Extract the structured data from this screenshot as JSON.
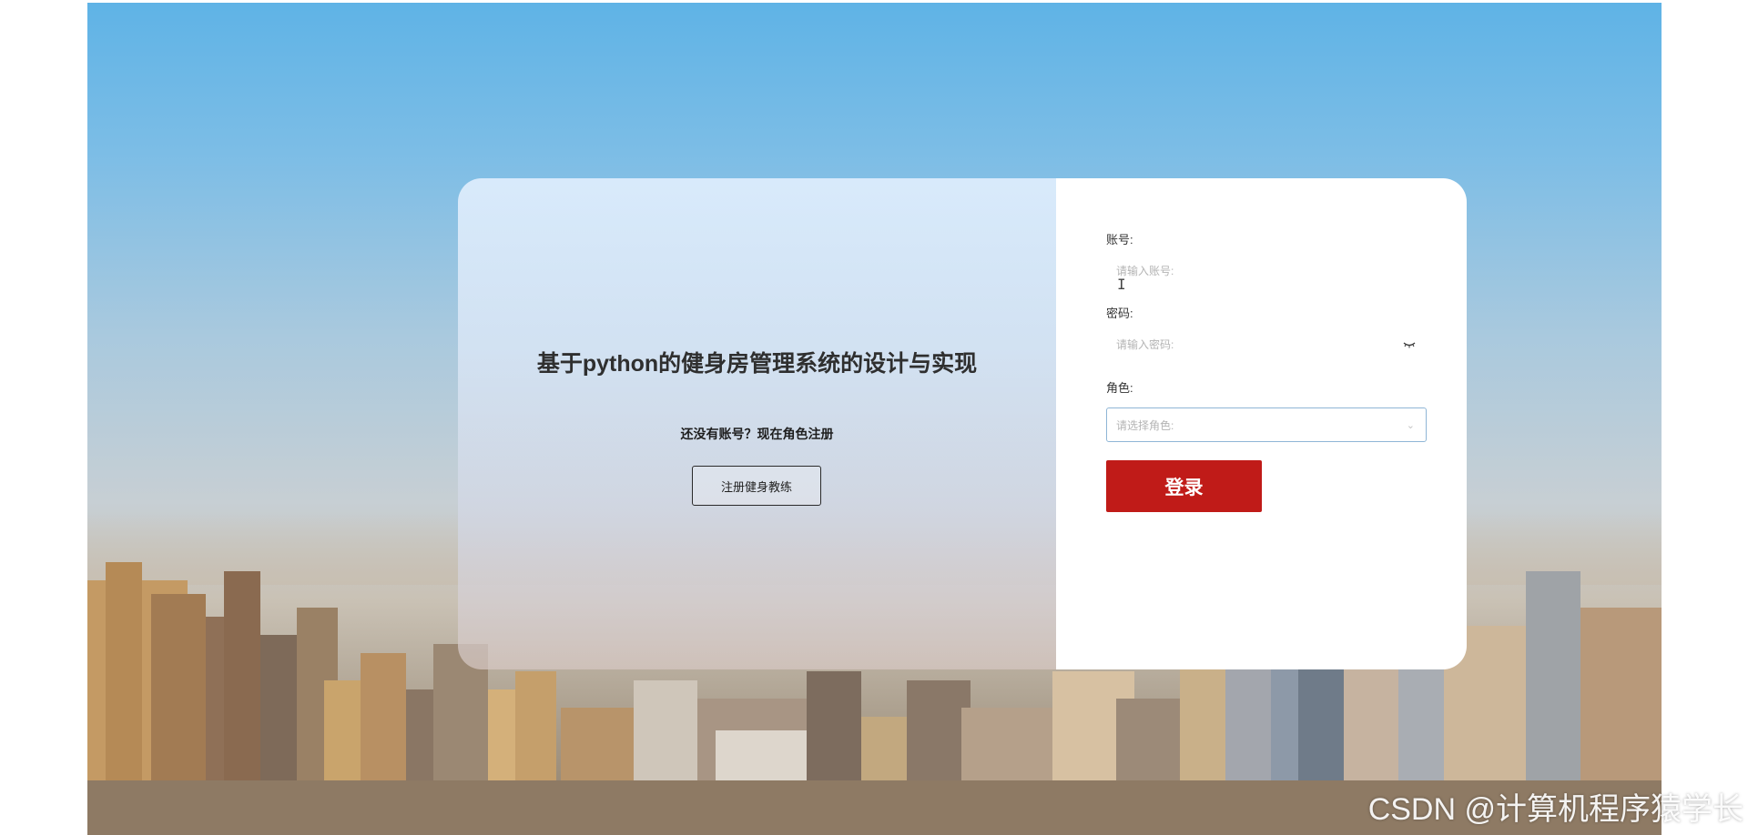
{
  "left_panel": {
    "title": "基于python的健身房管理系统的设计与实现",
    "register_prompt": "还没有账号？现在角色注册",
    "register_button": "注册健身教练"
  },
  "login_form": {
    "account_label": "账号:",
    "account_placeholder": "请输入账号:",
    "password_label": "密码:",
    "password_placeholder": "请输入密码:",
    "role_label": "角色:",
    "role_placeholder": "请选择角色:",
    "login_button": "登录"
  },
  "watermark": "CSDN @计算机程序猿学长",
  "icons": {
    "password_toggle": "eye-closed-icon",
    "role_dropdown": "chevron-down-icon",
    "mouse_cursor": "text-cursor-icon"
  },
  "colors": {
    "login_button": "#c01b18",
    "select_border": "#8fb6d6"
  }
}
